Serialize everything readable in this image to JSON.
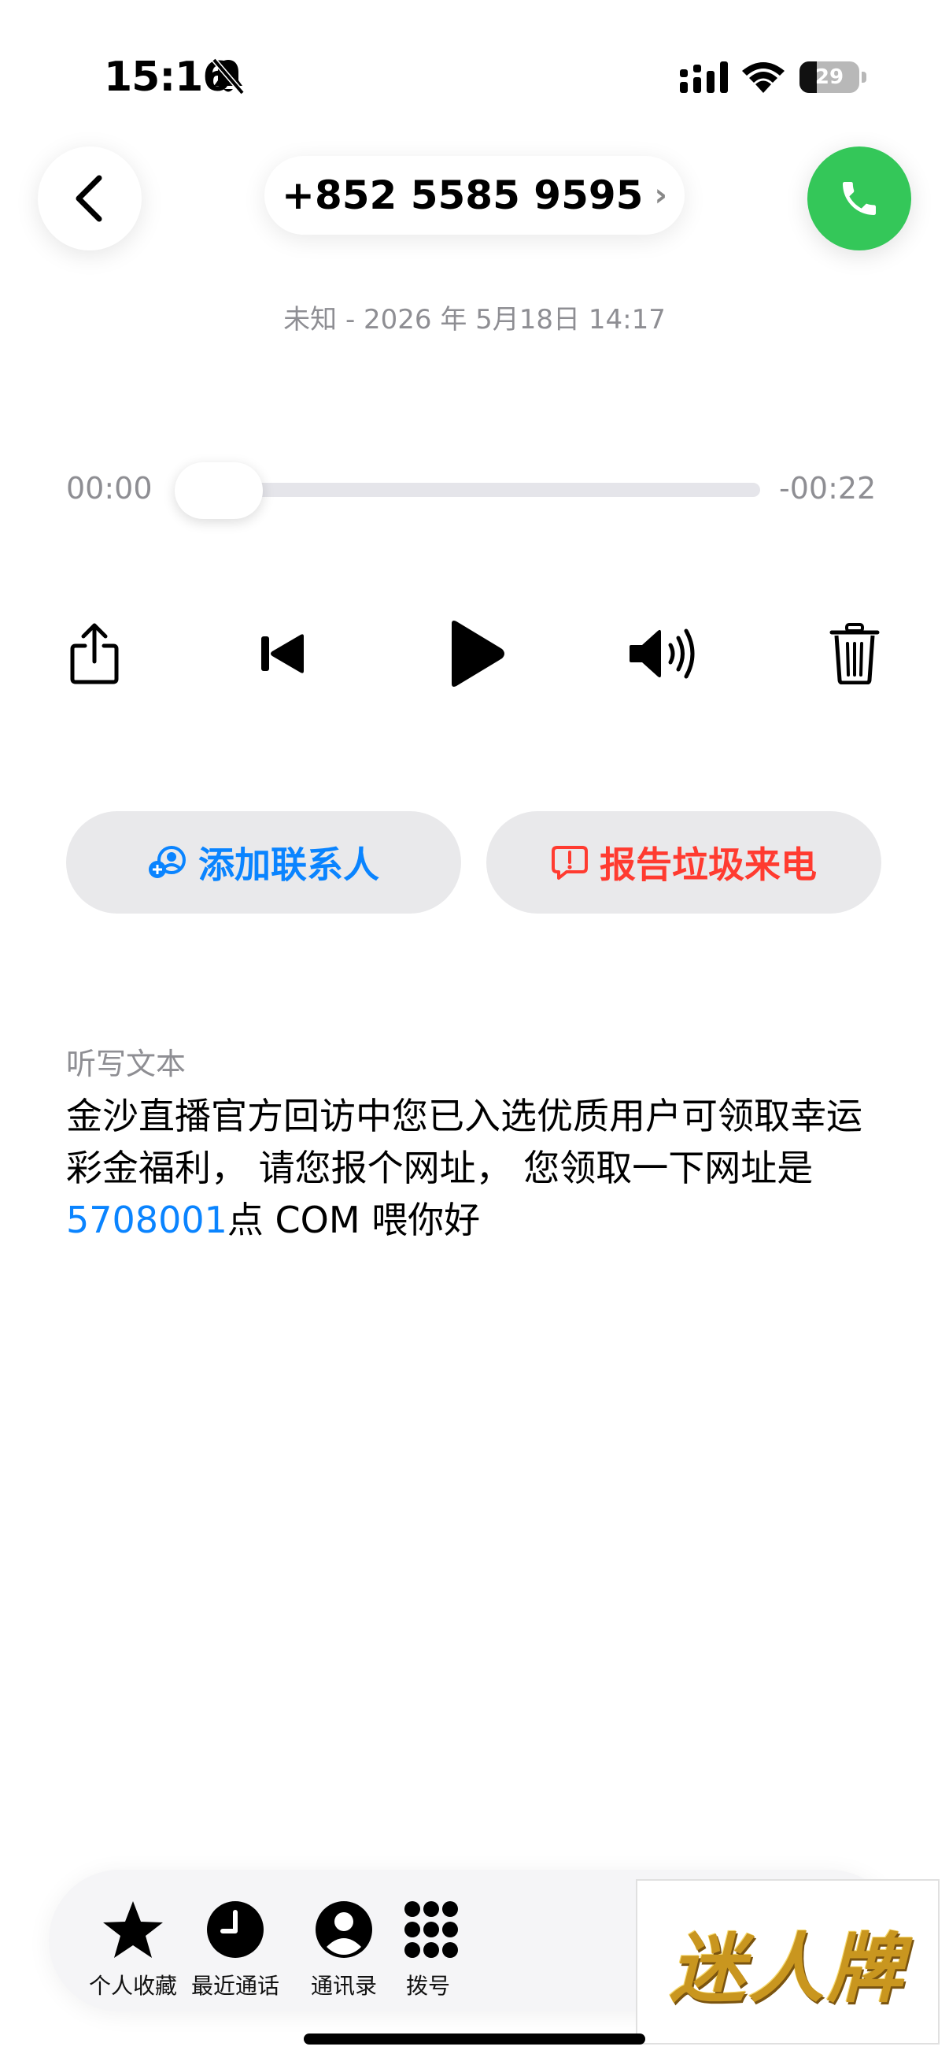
{
  "status_bar": {
    "time": "15:16",
    "battery_level": "29",
    "battery_fraction": 0.29
  },
  "header": {
    "phone_number": "+852 5585 9595",
    "number_chevron": "›",
    "call_meta": "未知 - 2026 年 5月18日 14:17"
  },
  "player": {
    "elapsed": "00:00",
    "remaining": "-00:22",
    "progress": 0.0
  },
  "actions": {
    "add_contact_label": "添加联系人",
    "report_spam_label": "报告垃圾来电"
  },
  "transcription": {
    "label": "听写文本",
    "text_before_link": "金沙直播官方回访中您已入选优质用户可领取幸运彩金福利， 请您报个网址， 您领取一下网址是 ",
    "link_text": "5708001",
    "text_after_link": "点 COM 喂你好"
  },
  "tabbar": {
    "items": [
      {
        "label": "个人收藏",
        "icon": "star-icon"
      },
      {
        "label": "最近通话",
        "icon": "clock-icon"
      },
      {
        "label": "通讯录",
        "icon": "person-icon"
      },
      {
        "label": "拨号",
        "icon": "keypad-icon"
      }
    ]
  },
  "watermark": {
    "text": "迷人牌"
  },
  "colors": {
    "accent_blue": "#0a84ff",
    "danger_red": "#ff3b30",
    "call_green": "#34c759",
    "secondary_gray": "#8e8e93"
  }
}
